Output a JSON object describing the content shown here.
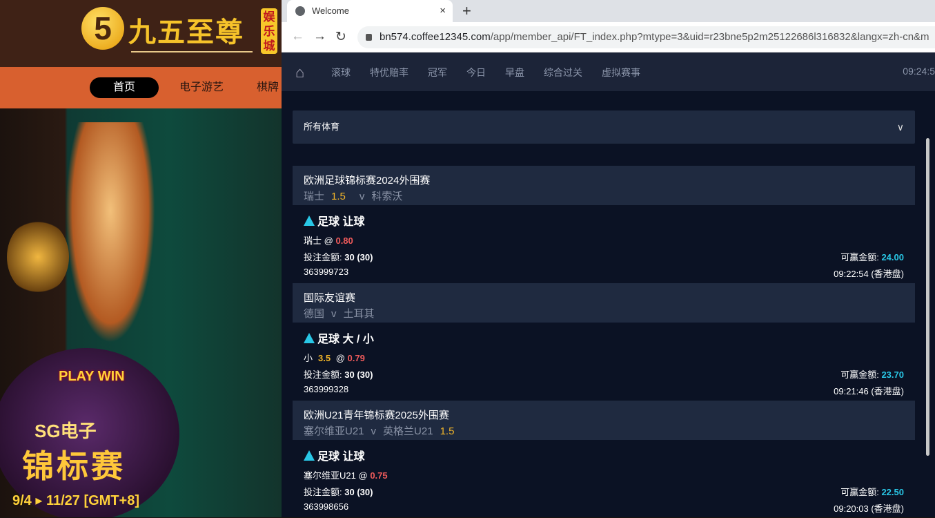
{
  "background_site": {
    "logo_text": "九五至尊",
    "logo_digit": "5",
    "logo_badge": "娱乐城",
    "nav": [
      "首页",
      "电子游艺",
      "棋牌"
    ],
    "promo": {
      "play_win": "PLAY WIN",
      "brand": "SG电子",
      "title": "锦标赛",
      "dates": "9/4 ▸ 11/27 [GMT+8]"
    }
  },
  "browser": {
    "tab_title": "Welcome",
    "tab_close": "×",
    "new_tab": "+",
    "url_host": "bn574.coffee12345.com",
    "url_path": "/app/member_api/FT_index.php?mtype=3&uid=r23bne5p2m25122686l316832&langx=zh-cn&m"
  },
  "site_nav": {
    "items": [
      "滚球",
      "特优赔率",
      "冠军",
      "今日",
      "早盘",
      "综合过关",
      "虚拟赛事"
    ],
    "clock": "09:24:5"
  },
  "filter": {
    "selected": "所有体育"
  },
  "bets": [
    {
      "league": "欧洲足球锦标赛2024外围赛",
      "home": "瑞士",
      "away": "科索沃",
      "handicap": "1.5",
      "handicap_side": "home",
      "v": "v",
      "type": "足球 让球",
      "pick": "瑞士",
      "pick_line": "",
      "at": "@",
      "odds": "0.80",
      "stake_label": "投注金额:",
      "stake": "30 (30)",
      "win_label": "可赢金额:",
      "win": "24.00",
      "ticket": "363999723",
      "time": "09:22:54 (香港盘)"
    },
    {
      "league": "国际友谊赛",
      "home": "德国",
      "away": "土耳其",
      "handicap": "",
      "handicap_side": "",
      "v": "v",
      "type": "足球 大 / 小",
      "pick": "小",
      "pick_line": "3.5",
      "at": "@",
      "odds": "0.79",
      "stake_label": "投注金额:",
      "stake": "30 (30)",
      "win_label": "可赢金额:",
      "win": "23.70",
      "ticket": "363999328",
      "time": "09:21:46 (香港盘)"
    },
    {
      "league": "欧洲U21青年锦标赛2025外围赛",
      "home": "塞尔维亚U21",
      "away": "英格兰U21",
      "handicap": "1.5",
      "handicap_side": "away",
      "v": "v",
      "type": "足球 让球",
      "pick": "塞尔维亚U21",
      "pick_line": "",
      "at": "@",
      "odds": "0.75",
      "stake_label": "投注金额:",
      "stake": "30 (30)",
      "win_label": "可赢金额:",
      "win": "22.50",
      "ticket": "363998656",
      "time": "09:20:03 (香港盘)"
    }
  ]
}
